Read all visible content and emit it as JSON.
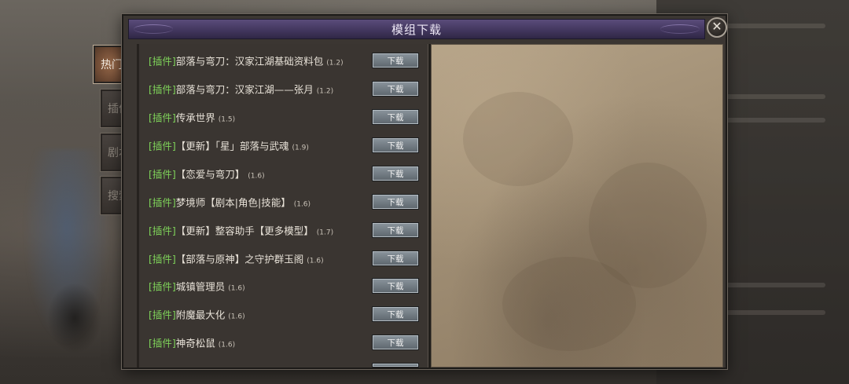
{
  "dialog": {
    "title": "模组下载",
    "close_symbol": "✕"
  },
  "tabs": [
    {
      "label": "热门",
      "active": true
    },
    {
      "label": "插件",
      "active": false
    },
    {
      "label": "剧本",
      "active": false
    },
    {
      "label": "搜索",
      "active": false
    }
  ],
  "mods": [
    {
      "tag": "[插件]",
      "name": "部落与弯刀：汉家江湖基础资料包",
      "version": "(1.2)",
      "button": "下载"
    },
    {
      "tag": "[插件]",
      "name": "部落与弯刀：汉家江湖——张月",
      "version": "(1.2)",
      "button": "下载"
    },
    {
      "tag": "[插件]",
      "name": "传承世界",
      "version": "(1.5)",
      "button": "下载"
    },
    {
      "tag": "[插件]",
      "name": "【更新】「星」部落与武魂",
      "version": "(1.9)",
      "button": "下载"
    },
    {
      "tag": "[插件]",
      "name": "【恋爱与弯刀】",
      "version": "(1.6)",
      "button": "下载"
    },
    {
      "tag": "[插件]",
      "name": "梦境师【剧本|角色|技能】",
      "version": "(1.6)",
      "button": "下载"
    },
    {
      "tag": "[插件]",
      "name": "【更新】整容助手【更多模型】",
      "version": "(1.7)",
      "button": "下载"
    },
    {
      "tag": "[插件]",
      "name": "【部落与原神】之守护群玉阁",
      "version": "(1.6)",
      "button": "下载"
    },
    {
      "tag": "[插件]",
      "name": "城镇管理员",
      "version": "(1.6)",
      "button": "下载"
    },
    {
      "tag": "[插件]",
      "name": "附魔最大化",
      "version": "(1.6)",
      "button": "下载"
    },
    {
      "tag": "[插件]",
      "name": "神奇松鼠",
      "version": "(1.6)",
      "button": "下载"
    }
  ]
}
